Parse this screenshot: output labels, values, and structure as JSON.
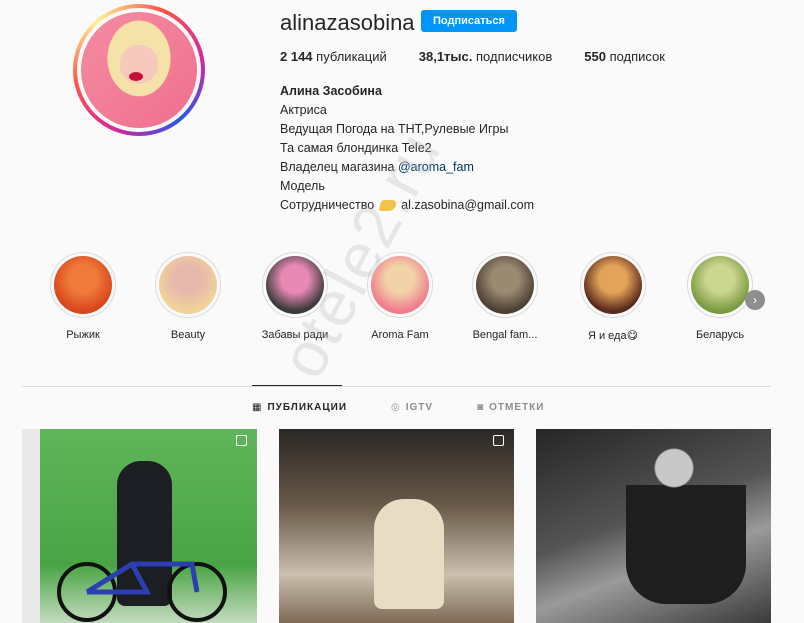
{
  "profile": {
    "username": "alinazasobina",
    "follow_label": "Подписаться",
    "stats": {
      "posts_count": "2 144",
      "posts_label": "публикаций",
      "followers_count": "38,1тыс.",
      "followers_label": "подписчиков",
      "following_count": "550",
      "following_label": "подписок"
    },
    "bio": {
      "name": "Алина Засобина",
      "line1": "Актриса",
      "line2": "Ведущая Погода на ТНТ,Рулевые Игры",
      "line3": "Та самая блондинка Tele2",
      "line4_prefix": "Владелец магазина ",
      "line4_mention": "@aroma_fam",
      "line5": "Модель",
      "line6_prefix": "Сотрудничество",
      "line6_email": "al.zasobina@gmail.com"
    }
  },
  "watermark": "otele2.ru",
  "highlights": [
    {
      "label": "Рыжик",
      "color1": "#d8461c",
      "color2": "#f07a3a"
    },
    {
      "label": "Beauty",
      "color1": "#f1d49a",
      "color2": "#e7b8ac"
    },
    {
      "label": "Забавы ради",
      "color1": "#3a3a3a",
      "color2": "#e889b5"
    },
    {
      "label": "Aroma Fam",
      "color1": "#f07c8e",
      "color2": "#f2d3a8"
    },
    {
      "label": "Bengal fam...",
      "color1": "#4d4034",
      "color2": "#9b8a72"
    },
    {
      "label": "Я и еда😋",
      "color1": "#5a2a1c",
      "color2": "#e3a35a"
    },
    {
      "label": "Беларусь",
      "color1": "#7a9a42",
      "color2": "#cbd68f"
    }
  ],
  "next_icon": "chevron-right-icon",
  "tabs": [
    {
      "label": "ПУБЛИКАЦИИ",
      "icon": "grid-icon",
      "active": true
    },
    {
      "label": "IGTV",
      "icon": "igtv-icon",
      "active": false
    },
    {
      "label": "ОТМЕТКИ",
      "icon": "tagged-icon",
      "active": false
    }
  ],
  "colors": {
    "accent": "#0095f6",
    "mention": "#00376b"
  }
}
